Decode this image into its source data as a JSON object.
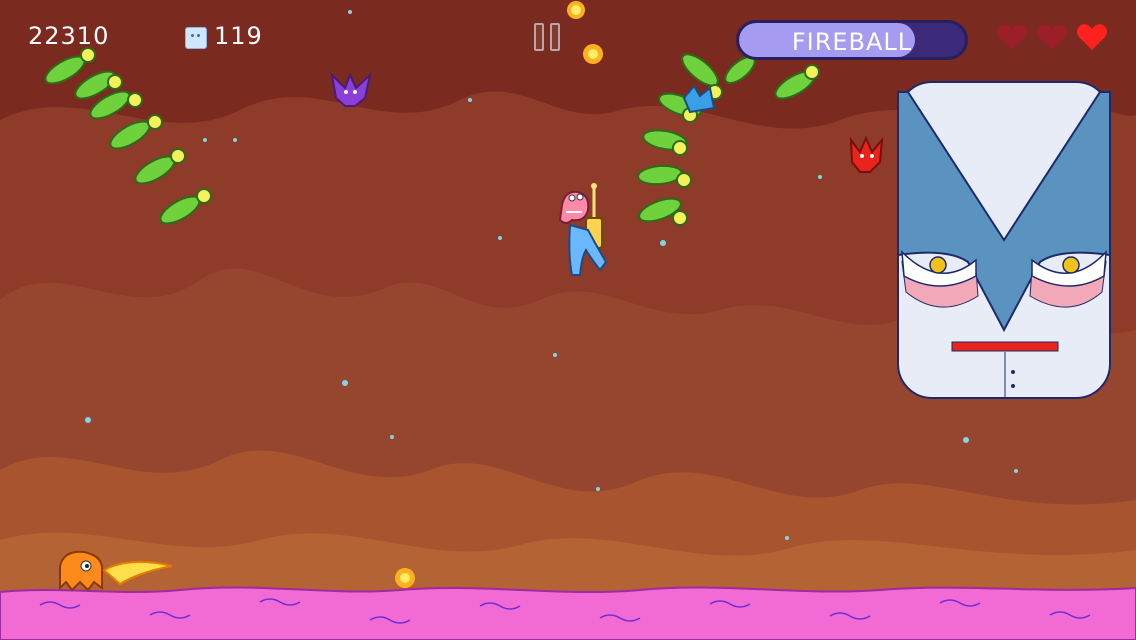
{
  "hud": {
    "score": "22310",
    "gem_count": "119",
    "powerup_label": "FIREBALL",
    "powerup_remaining": 0.78,
    "lives": {
      "total": 3,
      "remaining": 1
    }
  },
  "colors": {
    "sky": "#7a2a1e",
    "ground": "#f26ad4",
    "heart_full": "#ff2020",
    "heart_empty": "#9a1f26",
    "powerup_fill": "#a59bf0",
    "caterpillar": "#6fd13b",
    "boss_face": "#e8ecf7",
    "boss_mask": "#5b93c0"
  },
  "icons": {
    "gem": "gem-icon",
    "pause": "pause-icon",
    "heart": "heart-icon"
  }
}
